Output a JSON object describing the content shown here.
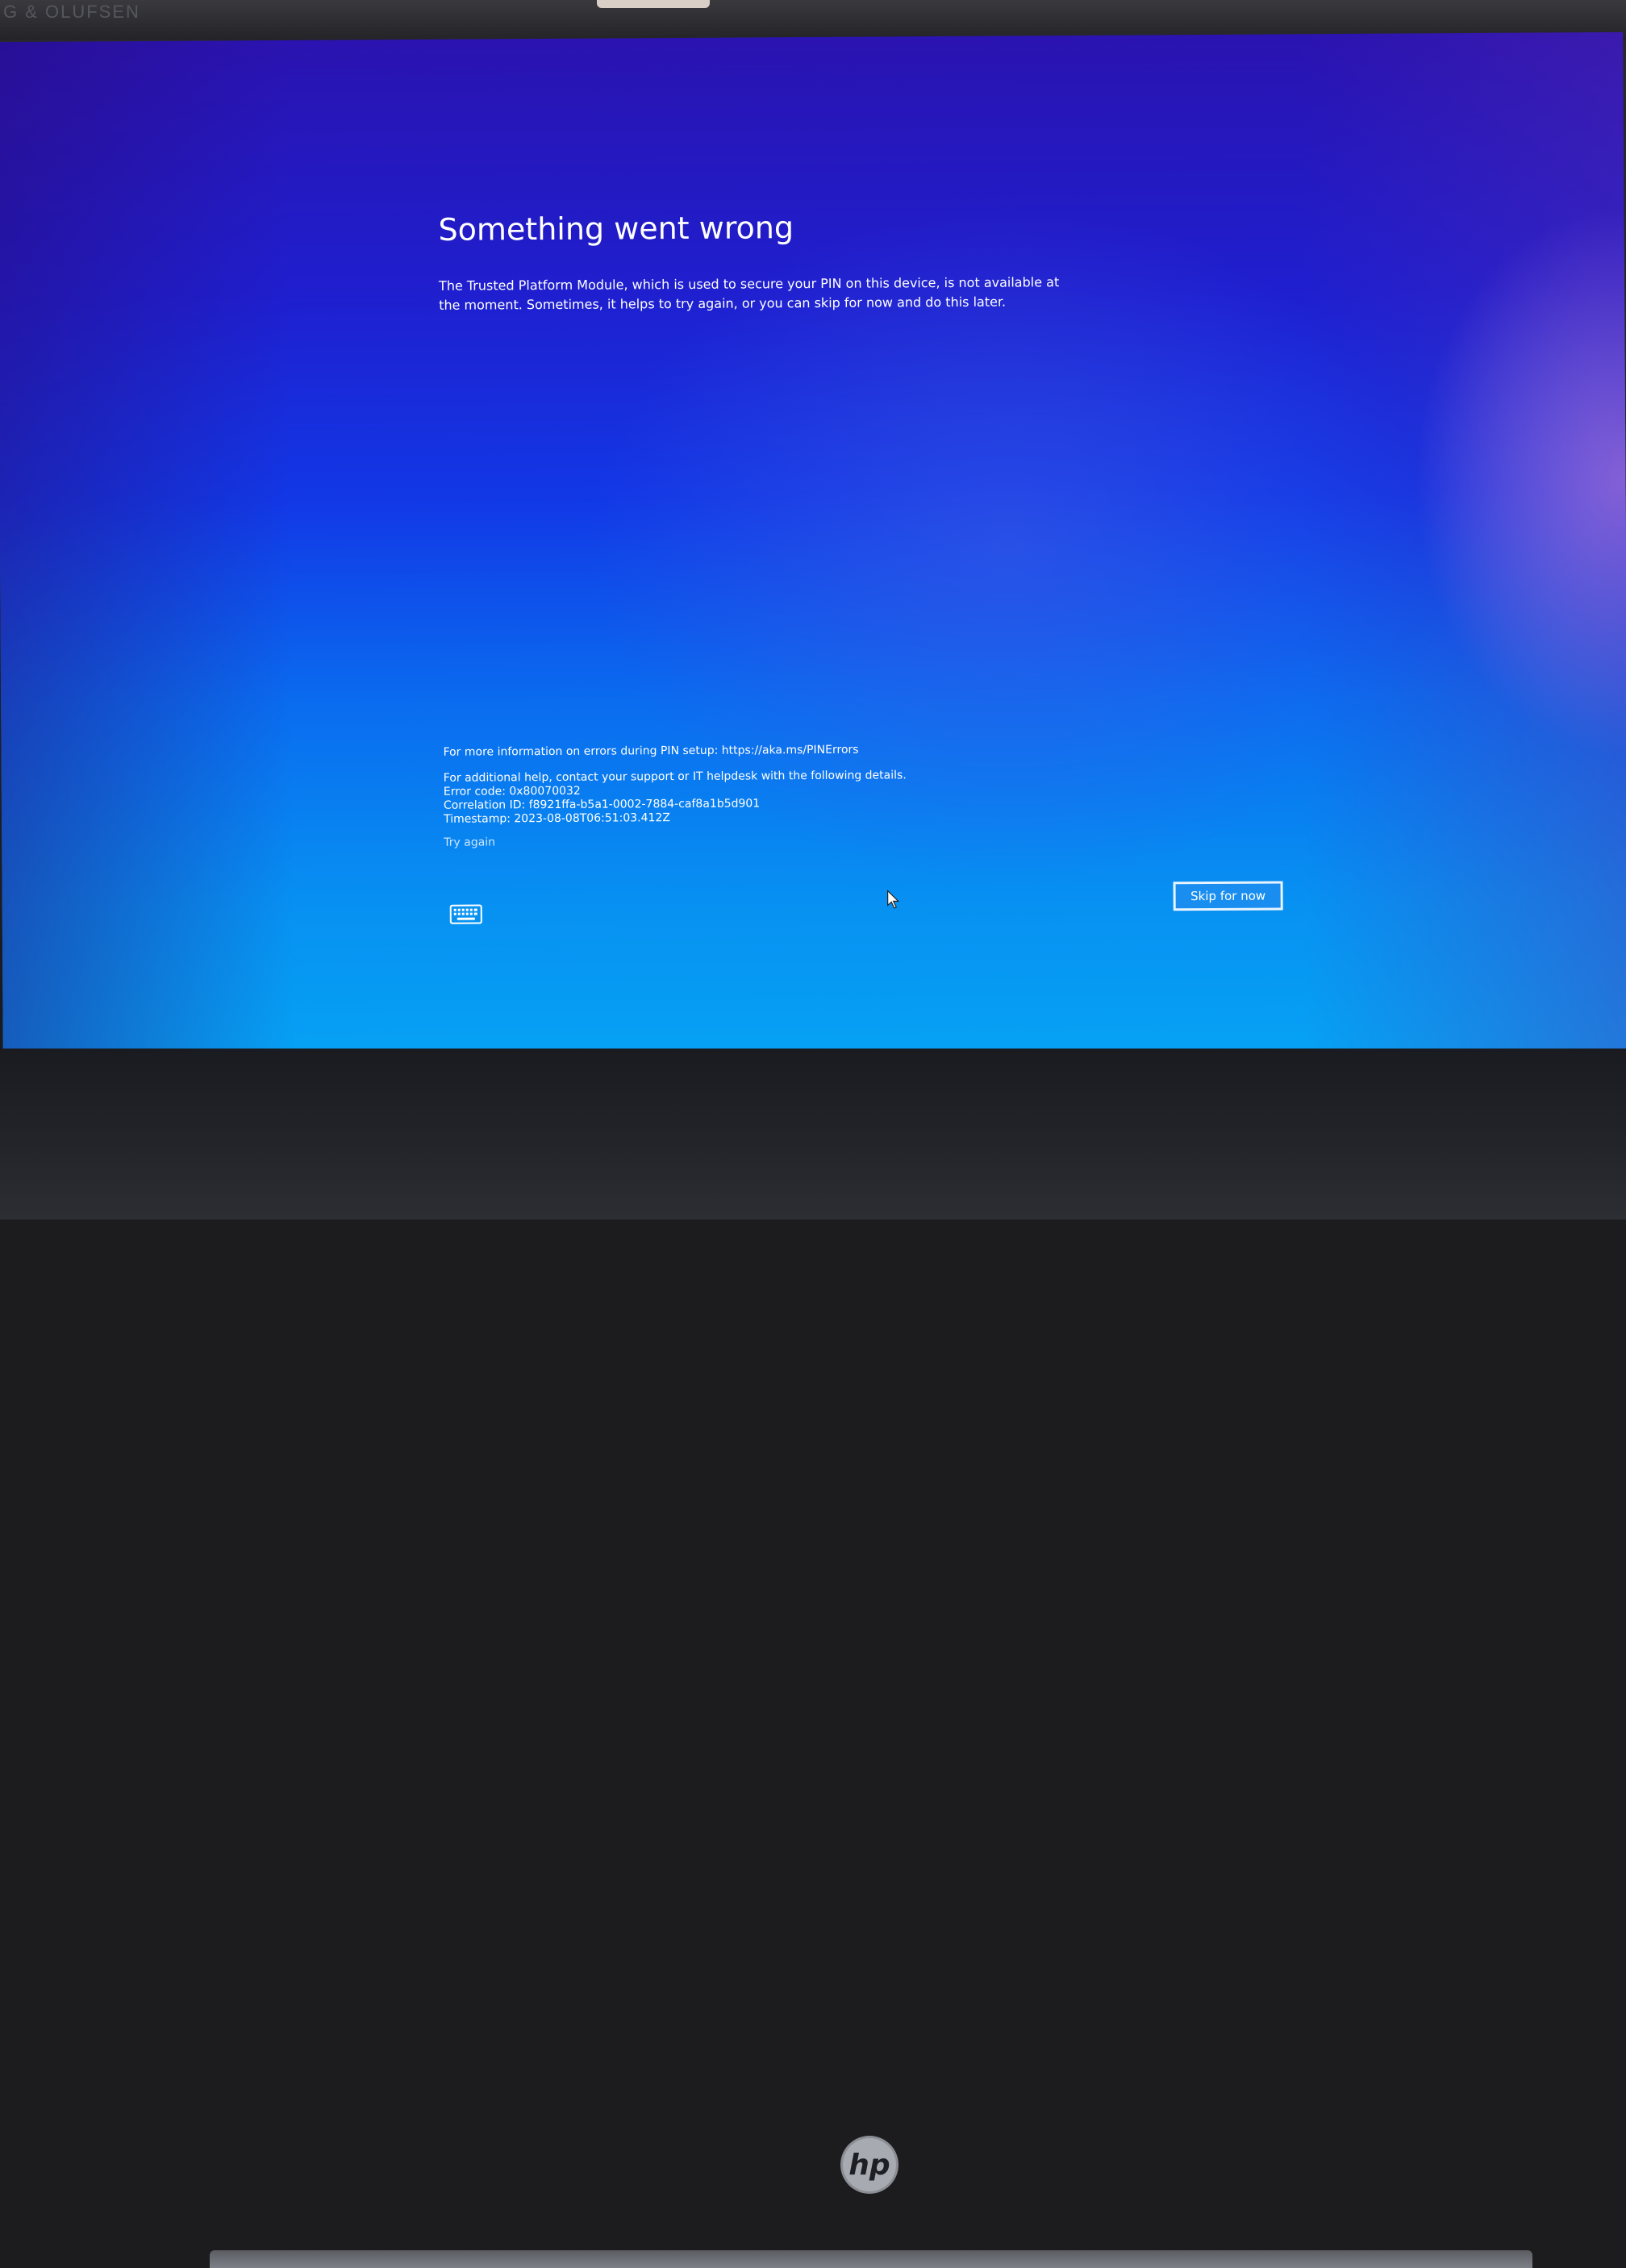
{
  "device": {
    "bezel_brand": "G & OLUFSEN",
    "logo_icon": "hp-logo-icon"
  },
  "dialog": {
    "title": "Something went wrong",
    "message": "The Trusted Platform Module, which is used to secure your PIN on this device, is not available at the moment. Sometimes, it helps to try again, or you can skip for now and do this later.",
    "info_line": "For more information on errors during PIN setup: https://aka.ms/PINErrors",
    "help_intro": "For additional help, contact your support or IT helpdesk with the following details.",
    "error_code": "Error code: 0x80070032",
    "correlation_id": "Correlation ID: f8921ffa-b5a1-0002-7884-caf8a1b5d901",
    "timestamp": "Timestamp: 2023-08-08T06:51:03.412Z",
    "try_again_label": "Try again",
    "skip_label": "Skip for now",
    "keyboard_icon": "keyboard-icon"
  },
  "colors": {
    "text": "#ffffff",
    "link": "#cfe6ff",
    "button_fill": "#1a8ef0",
    "button_border": "#e8f4ff",
    "screen_top": "#2a13b0",
    "screen_bottom": "#06a2f4"
  }
}
